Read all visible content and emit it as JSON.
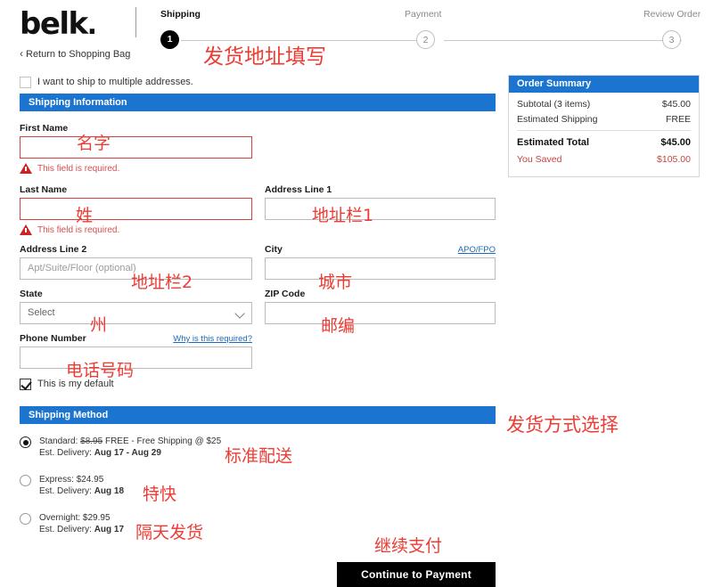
{
  "brand": {
    "logo_text": "belk",
    "logo_dot": "."
  },
  "header": {
    "return_link": "Return to Shopping Bag",
    "chevron": "‹"
  },
  "stepper": {
    "steps": [
      {
        "label": "Shipping",
        "number": "1",
        "state": "active"
      },
      {
        "label": "Payment",
        "number": "2",
        "state": "idle"
      },
      {
        "label": "Review Order",
        "number": "3",
        "state": "idle"
      }
    ]
  },
  "multi_address": {
    "label": "I want to ship to multiple addresses.",
    "checked": false
  },
  "shipping_information": {
    "section_title": "Shipping Information",
    "first_name": {
      "label": "First Name",
      "value": "",
      "placeholder": "",
      "error": "This field is required."
    },
    "last_name": {
      "label": "Last Name",
      "value": "",
      "placeholder": "",
      "error": "This field is required."
    },
    "address1": {
      "label": "Address Line 1",
      "value": "",
      "placeholder": ""
    },
    "address2": {
      "label": "Address Line 2",
      "value": "",
      "placeholder": "Apt/Suite/Floor (optional)"
    },
    "city": {
      "label": "City",
      "value": "",
      "placeholder": "",
      "link": "APO/FPO"
    },
    "state": {
      "label": "State",
      "value": "Select"
    },
    "zip": {
      "label": "ZIP Code",
      "value": "",
      "placeholder": ""
    },
    "phone": {
      "label": "Phone Number",
      "value": "",
      "placeholder": "",
      "link": "Why is this required?"
    },
    "default_checkbox": {
      "label": "This is my default",
      "checked": true
    }
  },
  "shipping_method": {
    "section_title": "Shipping Method",
    "options": [
      {
        "selected": true,
        "name": "Standard:",
        "old_price": "$8.95",
        "price": "FREE",
        "note": "- Free Shipping @ $25",
        "delivery_label": "Est. Delivery:",
        "delivery_value": "Aug 17 - Aug 29"
      },
      {
        "selected": false,
        "name": "Express:",
        "old_price": "",
        "price": "$24.95",
        "note": "",
        "delivery_label": "Est. Delivery:",
        "delivery_value": "Aug 18"
      },
      {
        "selected": false,
        "name": "Overnight:",
        "old_price": "",
        "price": "$29.95",
        "note": "",
        "delivery_label": "Est. Delivery:",
        "delivery_value": "Aug 17"
      }
    ]
  },
  "continue_button": {
    "label": "Continue to Payment"
  },
  "order_summary": {
    "title": "Order Summary",
    "subtotal_label": "Subtotal (3 items)",
    "subtotal_value": "$45.00",
    "shipping_label": "Estimated Shipping",
    "shipping_value": "FREE",
    "total_label": "Estimated Total",
    "total_value": "$45.00",
    "saved_label": "You Saved",
    "saved_value": "$105.00"
  },
  "annotations": {
    "a1": "发货地址填写",
    "a2": "名字",
    "a3": "姓",
    "a4": "地址栏1",
    "a5": "地址栏2",
    "a6": "城市",
    "a7": "州",
    "a8": "邮编",
    "a9": "电话号码",
    "a10": "发货方式选择",
    "a11": "标准配送",
    "a12": "特快",
    "a13": "隔天发货",
    "a14": "继续支付"
  },
  "colors": {
    "accent_blue": "#1b74cf",
    "error_red": "#d94040",
    "annotation_red": "#ee3b33",
    "link_blue": "#1a6bbd",
    "saved_red": "#c4463f"
  }
}
